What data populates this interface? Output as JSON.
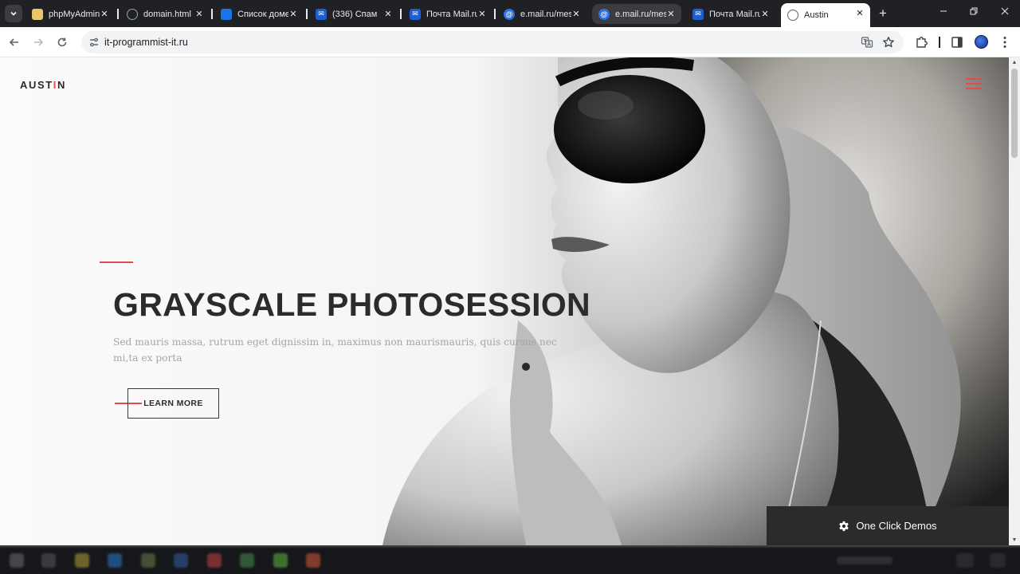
{
  "browser": {
    "tabs": [
      {
        "title": "phpMyAdmin",
        "icon": "phpmyadmin-icon",
        "color": "#e8c76a",
        "active": false
      },
      {
        "title": "domain.html",
        "icon": "globe-icon",
        "color": "#9aa0a6",
        "active": false
      },
      {
        "title": "Список доменов",
        "icon": "doc-icon",
        "color": "#1a73e8",
        "active": false
      },
      {
        "title": "(336) Спам",
        "icon": "mail-icon",
        "color": "#1a5fd6",
        "active": false
      },
      {
        "title": "Почта Mail.ru",
        "icon": "mail-icon",
        "color": "#1a5fd6",
        "active": false
      },
      {
        "title": "e.mail.ru/messages",
        "icon": "at-icon",
        "color": "#2f6fe0",
        "active": false
      },
      {
        "title": "e.mail.ru/messages",
        "icon": "at-icon",
        "color": "#2f6fe0",
        "active": false,
        "hover": true
      },
      {
        "title": "Почта Mail.ru",
        "icon": "mail-icon",
        "color": "#1a5fd6",
        "active": false
      },
      {
        "title": "Austin",
        "icon": "globe-icon",
        "color": "#5f6368",
        "active": true
      }
    ],
    "address": "it-programmist-it.ru"
  },
  "site": {
    "logo_main": "AUST",
    "logo_accent": "I",
    "logo_end": "N",
    "headline": "GRAYSCALE PHOTOSESSION",
    "lead": "Sed mauris massa, rutrum eget dignissim in, maximus non maurismauris, quis cursus nec mi,ta ex porta",
    "button_label": "LEARN MORE",
    "demos_label": "One Click Demos",
    "accent_color": "#e54b4b"
  }
}
